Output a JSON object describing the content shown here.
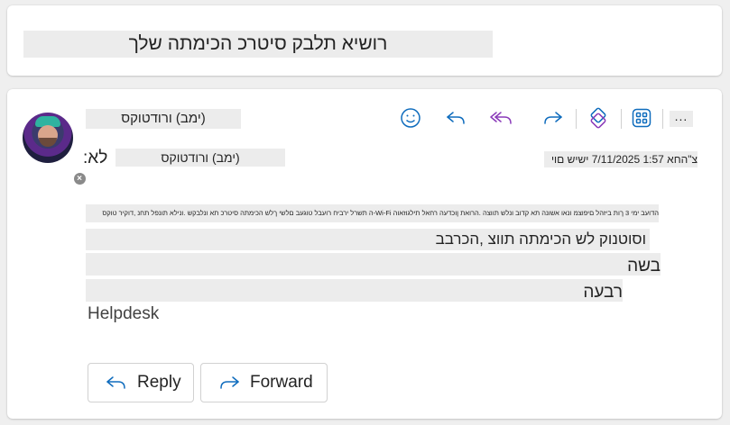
{
  "subject": {
    "text": "רושיא תלבק סיטרכ הכימתה שלך"
  },
  "header": {
    "sender_name": "(ימב) ורודטוקס",
    "to_label": "לא:",
    "to_value": "(ימב) ורודטוקס",
    "date": "צ\"החא 1:57 7/11/2025 ישיש םוי"
  },
  "toolbar": {
    "more_label": "...",
    "items": [
      {
        "name": "emoji-icon"
      },
      {
        "name": "reply-icon"
      },
      {
        "name": "reply-all-icon"
      },
      {
        "name": "forward-icon"
      },
      {
        "name": "tag-icon"
      },
      {
        "name": "apps-icon"
      }
    ],
    "accent_blue": "#0f6cbd",
    "accent_purple": "#8a3ab9"
  },
  "body": {
    "small_line": "הדועב ימי 3 ךות ביזהל םיפוצמ ונאו אשונה תא קדוב ונלש תווצה .הרואת ןוכדעה רחאל תילגוזאוה Wi-Fi-ה תשרל ירביח רועבל טוגעב םלשי ךלש הכימתה סיטרכ תא ונלבקש .ונילא תונפל תחנ ,דוקיר טוקס",
    "line1": "וסוטנוק לש הכימתה תווצ ,הכרבב",
    "line2": "בשה",
    "line3": "רבעה",
    "signature": "Helpdesk"
  },
  "actions": {
    "reply_label": "Reply",
    "forward_label": "Forward"
  }
}
